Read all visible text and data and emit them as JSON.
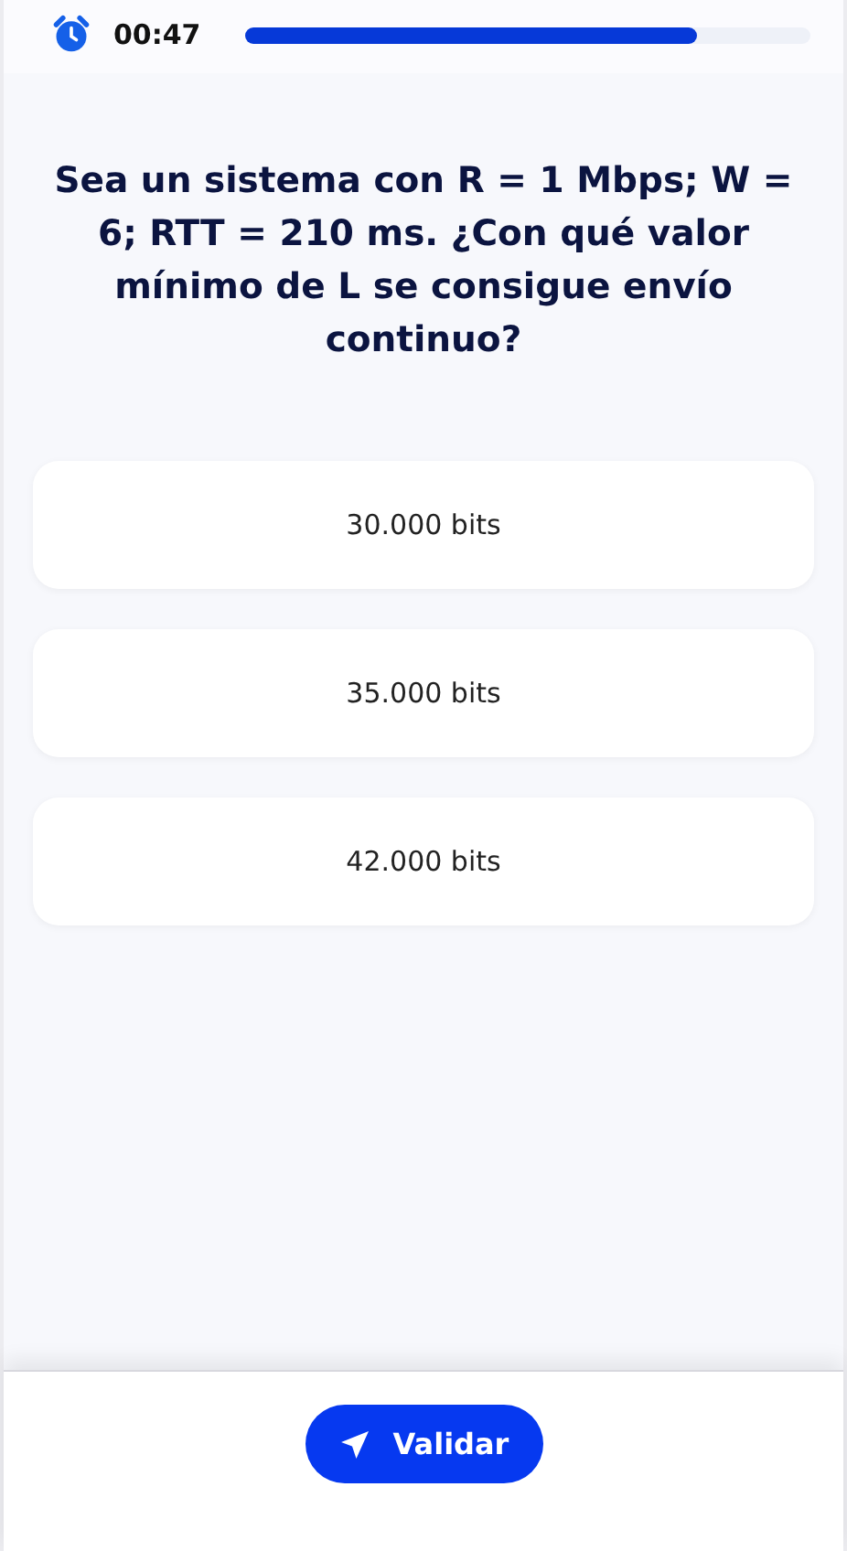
{
  "timer": {
    "time": "00:47",
    "level": 0.8
  },
  "question": "Sea un sistema con R = 1 Mbps; W = 6; RTT = 210 ms.  ¿Con qué valor mínimo de L se consigue envío continuo?",
  "options": [
    {
      "label": "30.000 bits"
    },
    {
      "label": "35.000 bits"
    },
    {
      "label": "42.000 bits"
    }
  ],
  "submit_button": {
    "label": "Validar"
  }
}
